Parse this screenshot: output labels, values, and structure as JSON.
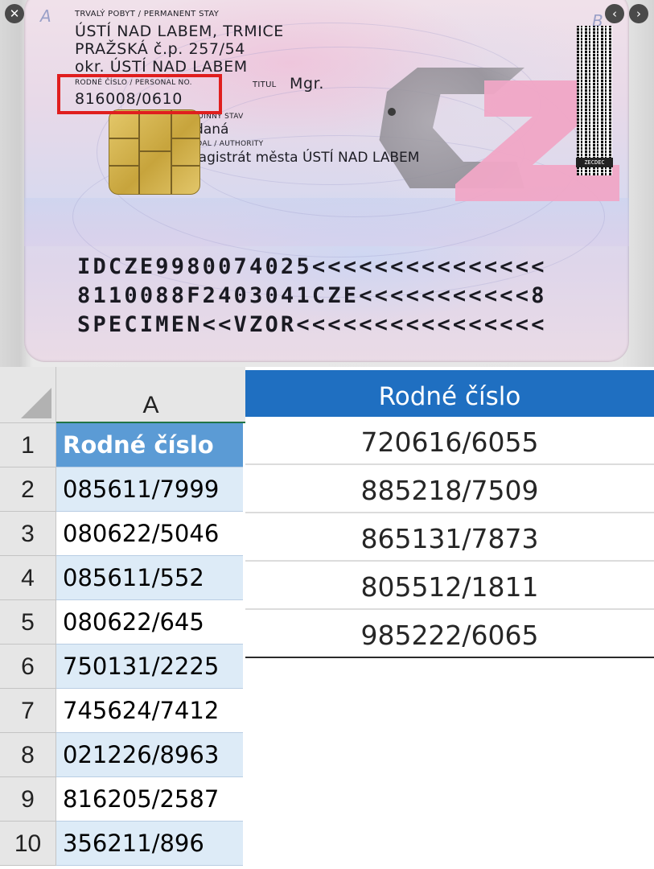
{
  "card": {
    "side_a": "A",
    "side_b": "B",
    "permanent_stay_label": "TRVALÝ POBYT / PERMANENT STAY",
    "address_line1": "ÚSTÍ NAD LABEM, TRMICE",
    "address_line2": "PRAŽSKÁ č.p. 257/54",
    "address_line3": "okr. ÚSTÍ NAD LABEM",
    "personal_no_label": "RODNÉ ČÍSLO / PERSONAL NO.",
    "personal_no": "816008/0610",
    "title_label": "TITUL",
    "title_value": "Mgr.",
    "marital_label": "RODINNÝ STAV",
    "marital_value": "vdaná",
    "authority_label": "VYDAL / AUTHORITY",
    "authority_value": "Magistrát města ÚSTÍ NAD LABEM",
    "barcode_label": "ZECDEC",
    "mrz": [
      "IDCZE9980074025<<<<<<<<<<<<<<<",
      "8110088F2403041CZE<<<<<<<<<<<8",
      "SPECIMEN<<VZOR<<<<<<<<<<<<<<<<"
    ],
    "highlight_color": "#e01e1e"
  },
  "viewer_controls": {
    "close_symbol": "✕",
    "prev_symbol": "‹",
    "next_symbol": "›"
  },
  "spreadsheet": {
    "column": "A",
    "rows": [
      {
        "num": "1",
        "value": "Rodné číslo"
      },
      {
        "num": "2",
        "value": "085611/7999"
      },
      {
        "num": "3",
        "value": "080622/5046"
      },
      {
        "num": "4",
        "value": "085611/552"
      },
      {
        "num": "5",
        "value": "080622/645"
      },
      {
        "num": "6",
        "value": "750131/2225"
      },
      {
        "num": "7",
        "value": "745624/7412"
      },
      {
        "num": "8",
        "value": "021226/8963"
      },
      {
        "num": "9",
        "value": "816205/2587"
      },
      {
        "num": "10",
        "value": "356211/896"
      }
    ],
    "header_color": "#5b9bd5",
    "band_color": "#ddebf7"
  },
  "table": {
    "header": "Rodné číslo",
    "rows": [
      "720616/6055",
      "885218/7509",
      "865131/7873",
      "805512/1811",
      "985222/6065"
    ],
    "header_color": "#1f6fc1"
  }
}
